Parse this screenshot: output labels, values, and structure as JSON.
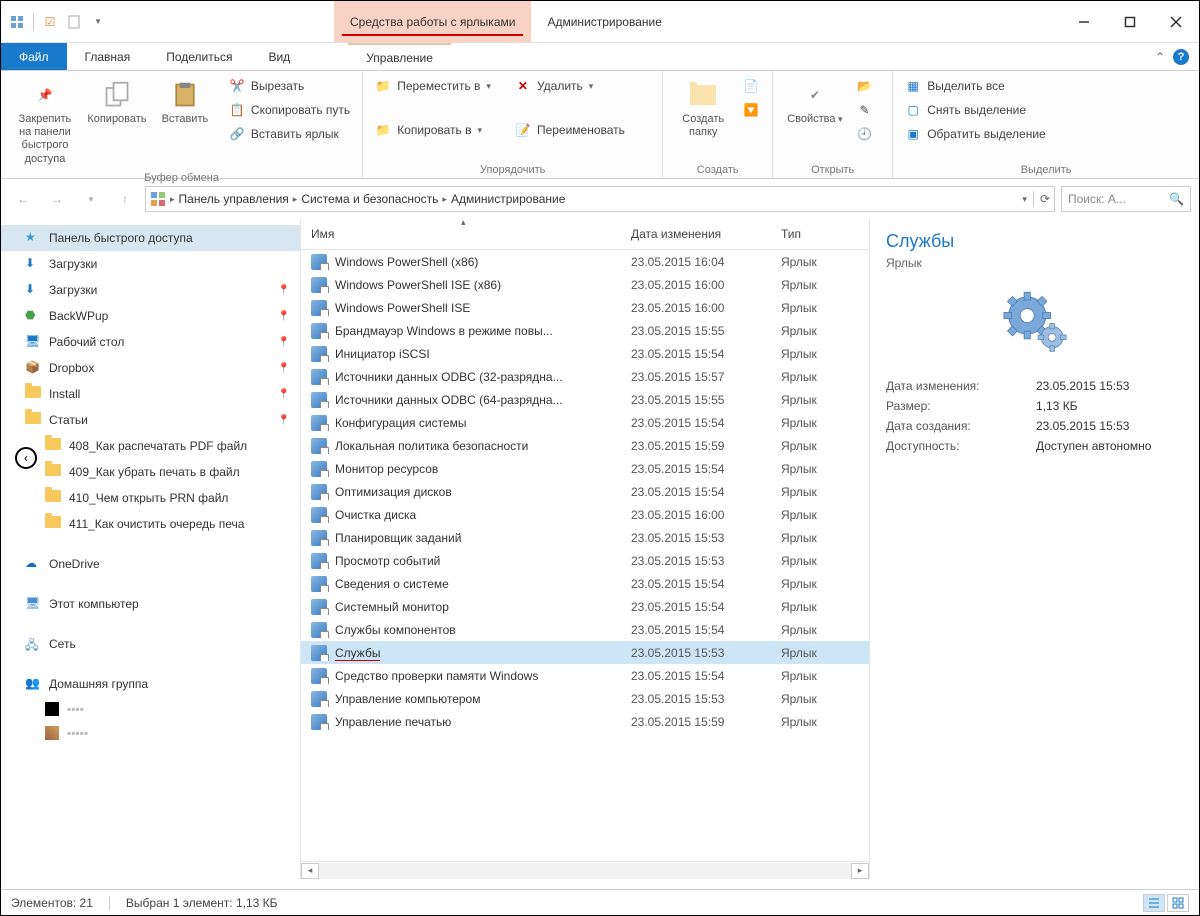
{
  "title": {
    "context_tab": "Средства работы с ярлыками",
    "main": "Администрирование"
  },
  "menu": {
    "file": "Файл",
    "home": "Главная",
    "share": "Поделиться",
    "view": "Вид",
    "manage": "Управление"
  },
  "ribbon": {
    "pin": "Закрепить на панели\nбыстрого доступа",
    "copy": "Копировать",
    "paste": "Вставить",
    "cut": "Вырезать",
    "copy_path": "Скопировать путь",
    "paste_shortcut": "Вставить ярлык",
    "move_to": "Переместить в",
    "copy_to": "Копировать в",
    "delete": "Удалить",
    "rename": "Переименовать",
    "new_folder": "Создать\nпапку",
    "properties": "Свойства",
    "select_all": "Выделить все",
    "select_none": "Снять выделение",
    "invert_sel": "Обратить выделение",
    "grp_clipboard": "Буфер обмена",
    "grp_organize": "Упорядочить",
    "grp_new": "Создать",
    "grp_open": "Открыть",
    "grp_select": "Выделить"
  },
  "breadcrumbs": [
    "Панель управления",
    "Система и безопасность",
    "Администрирование"
  ],
  "search": {
    "placeholder": "Поиск: А..."
  },
  "columns": {
    "name": "Имя",
    "date": "Дата изменения",
    "type": "Тип"
  },
  "nav": {
    "quick_access": "Панель быстрого доступа",
    "items": [
      {
        "label": "Загрузки",
        "icon": "download"
      },
      {
        "label": "Загрузки",
        "icon": "download",
        "pinned": true
      },
      {
        "label": "BackWPup",
        "icon": "app",
        "pinned": true
      },
      {
        "label": "Рабочий стол",
        "icon": "desktop",
        "pinned": true
      },
      {
        "label": "Dropbox",
        "icon": "dropbox",
        "pinned": true
      },
      {
        "label": "Install",
        "icon": "folder",
        "pinned": true
      },
      {
        "label": "Статьи",
        "icon": "folder",
        "pinned": true
      },
      {
        "label": "408_Как распечатать PDF файл",
        "icon": "folder",
        "sub": true
      },
      {
        "label": "409_Как убрать печать в файл",
        "icon": "folder",
        "sub": true
      },
      {
        "label": "410_Чем открыть PRN файл",
        "icon": "folder",
        "sub": true
      },
      {
        "label": "411_Как очистить очередь печа",
        "icon": "folder",
        "sub": true
      }
    ],
    "onedrive": "OneDrive",
    "this_pc": "Этот компьютер",
    "network": "Сеть",
    "homegroup": "Домашняя группа"
  },
  "files": [
    {
      "name": "Windows PowerShell (x86)",
      "date": "23.05.2015 16:04",
      "type": "Ярлык"
    },
    {
      "name": "Windows PowerShell ISE (x86)",
      "date": "23.05.2015 16:00",
      "type": "Ярлык"
    },
    {
      "name": "Windows PowerShell ISE",
      "date": "23.05.2015 16:00",
      "type": "Ярлык"
    },
    {
      "name": "Брандмауэр Windows в режиме повы...",
      "date": "23.05.2015 15:55",
      "type": "Ярлык"
    },
    {
      "name": "Инициатор iSCSI",
      "date": "23.05.2015 15:54",
      "type": "Ярлык"
    },
    {
      "name": "Источники данных ODBC (32-разрядна...",
      "date": "23.05.2015 15:57",
      "type": "Ярлык"
    },
    {
      "name": "Источники данных ODBC (64-разрядна...",
      "date": "23.05.2015 15:55",
      "type": "Ярлык"
    },
    {
      "name": "Конфигурация системы",
      "date": "23.05.2015 15:54",
      "type": "Ярлык"
    },
    {
      "name": "Локальная политика безопасности",
      "date": "23.05.2015 15:59",
      "type": "Ярлык"
    },
    {
      "name": "Монитор ресурсов",
      "date": "23.05.2015 15:54",
      "type": "Ярлык"
    },
    {
      "name": "Оптимизация дисков",
      "date": "23.05.2015 15:54",
      "type": "Ярлык"
    },
    {
      "name": "Очистка диска",
      "date": "23.05.2015 16:00",
      "type": "Ярлык"
    },
    {
      "name": "Планировщик заданий",
      "date": "23.05.2015 15:53",
      "type": "Ярлык"
    },
    {
      "name": "Просмотр событий",
      "date": "23.05.2015 15:53",
      "type": "Ярлык"
    },
    {
      "name": "Сведения о системе",
      "date": "23.05.2015 15:54",
      "type": "Ярлык"
    },
    {
      "name": "Системный монитор",
      "date": "23.05.2015 15:54",
      "type": "Ярлык"
    },
    {
      "name": "Службы компонентов",
      "date": "23.05.2015 15:54",
      "type": "Ярлык"
    },
    {
      "name": "Службы",
      "date": "23.05.2015 15:53",
      "type": "Ярлык",
      "selected": true,
      "underline": true
    },
    {
      "name": "Средство проверки памяти Windows",
      "date": "23.05.2015 15:54",
      "type": "Ярлык"
    },
    {
      "name": "Управление компьютером",
      "date": "23.05.2015 15:53",
      "type": "Ярлык"
    },
    {
      "name": "Управление печатью",
      "date": "23.05.2015 15:59",
      "type": "Ярлык"
    }
  ],
  "preview": {
    "title": "Службы",
    "subtitle": "Ярлык",
    "rows": [
      {
        "k": "Дата изменения:",
        "v": "23.05.2015 15:53"
      },
      {
        "k": "Размер:",
        "v": "1,13 КБ"
      },
      {
        "k": "Дата создания:",
        "v": "23.05.2015 15:53"
      },
      {
        "k": "Доступность:",
        "v": "Доступен автономно"
      }
    ]
  },
  "status": {
    "count": "Элементов: 21",
    "selection": "Выбран 1 элемент: 1,13 КБ"
  }
}
